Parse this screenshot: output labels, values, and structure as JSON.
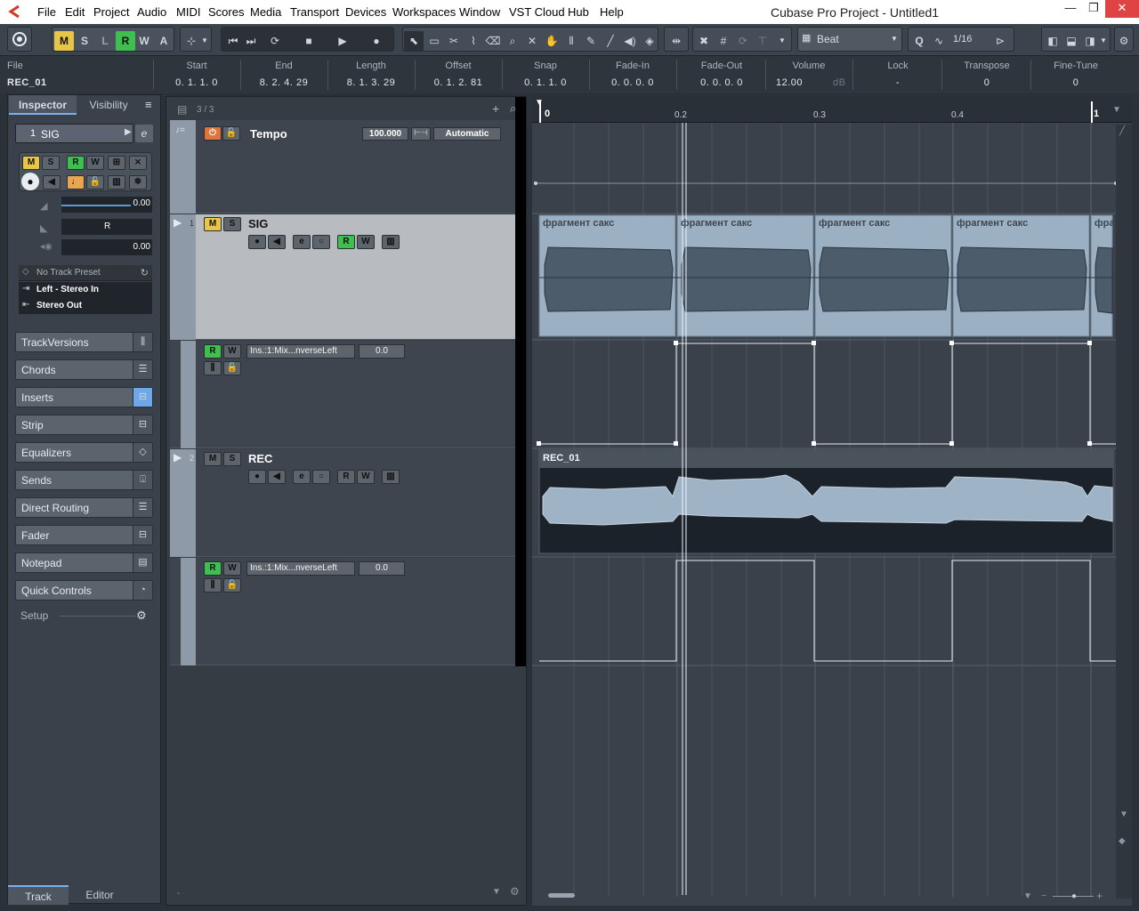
{
  "window": {
    "title": "Cubase Pro Project - Untitled1",
    "menu": [
      "File",
      "Edit",
      "Project",
      "Audio",
      "MIDI",
      "Scores",
      "Media",
      "Transport",
      "Devices",
      "Workspaces",
      "Window",
      "VST Cloud",
      "Hub",
      "Help"
    ],
    "controls": {
      "minimize": "—",
      "maximize": "❐",
      "close": "✕"
    }
  },
  "toolbar": {
    "msrwa": [
      "M",
      "S",
      "L",
      "R",
      "W",
      "A"
    ],
    "snap_type": "Beat",
    "quantize": "1/16",
    "quantize_label": "Q"
  },
  "infoline": {
    "file_header": "File",
    "file_value": "REC_01",
    "fields": [
      {
        "h": "Start",
        "v": "0. 1. 1.   0"
      },
      {
        "h": "End",
        "v": "8. 2. 4. 29"
      },
      {
        "h": "Length",
        "v": "8. 1. 3. 29"
      },
      {
        "h": "Offset",
        "v": "0. 1. 2. 81"
      },
      {
        "h": "Snap",
        "v": "0. 1. 1.   0"
      },
      {
        "h": "Fade-In",
        "v": "0. 0. 0.   0"
      },
      {
        "h": "Fade-Out",
        "v": "0. 0. 0.   0"
      },
      {
        "h": "Volume",
        "v": "12.00"
      },
      {
        "h": "Lock",
        "v": "-"
      },
      {
        "h": "Transpose",
        "v": "0"
      },
      {
        "h": "Fine-Tune",
        "v": "0"
      }
    ],
    "volume_unit": "dB"
  },
  "inspector": {
    "tabs": [
      "Inspector",
      "Visibility"
    ],
    "track_number": "1",
    "track_name": "SIG",
    "volume": "0.00",
    "pan": "R",
    "pan_value": "0.00",
    "preset": "No Track Preset",
    "input": "Left - Stereo In",
    "output": "Stereo Out",
    "sections": [
      "TrackVersions",
      "Chords",
      "Inserts",
      "Strip",
      "Equalizers",
      "Sends",
      "Direct Routing",
      "Fader",
      "Notepad",
      "Quick Controls"
    ],
    "setup": "Setup",
    "bottom_tabs": [
      "Track",
      "Editor"
    ]
  },
  "tracklist": {
    "counter": "3 / 3",
    "tempo_name": "Tempo",
    "tempo_value": "100.000",
    "tempo_mode": "Automatic",
    "tracks": [
      {
        "num": "1",
        "name": "SIG"
      },
      {
        "num": "2",
        "name": "REC"
      }
    ],
    "automation": [
      {
        "param": "Ins.:1:Mix...nverseLeft",
        "value": "0.0"
      },
      {
        "param": "Ins.:1:Mix...nverseLeft",
        "value": "0.0"
      }
    ]
  },
  "ruler": {
    "marks": [
      "0",
      "0.2",
      "0.3",
      "0.4",
      "1"
    ]
  },
  "events": {
    "sig_events": [
      "фрагмент сакс",
      "фрагмент сакс",
      "фрагмент сакс",
      "фрагмент сакс",
      "фра"
    ],
    "rec_event": "REC_01"
  },
  "colors": {
    "accent_green": "#3fbf4f",
    "accent_yellow": "#e8c547",
    "record_orange": "#e0753a"
  }
}
